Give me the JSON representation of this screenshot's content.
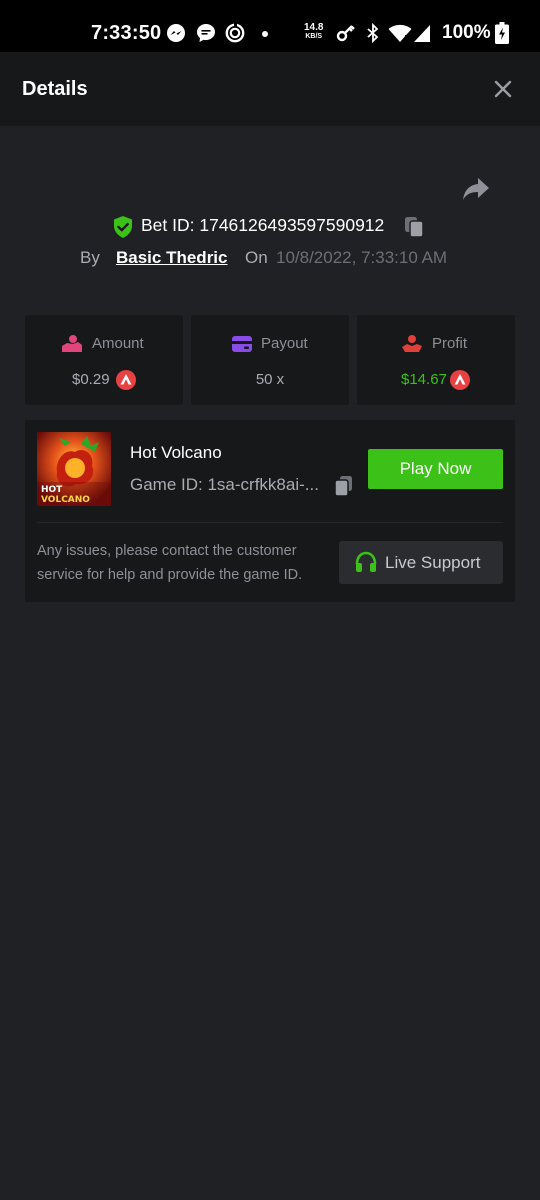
{
  "status_bar": {
    "time": "7:33:50",
    "network_speed_value": "14.8",
    "network_speed_unit": "KB/S",
    "battery": "100%"
  },
  "header": {
    "title": "Details"
  },
  "bet": {
    "id_text": "Bet ID: 1746126493597590912",
    "by_label": "By",
    "user": "Basic Thedric",
    "on_label": "On",
    "date": "10/8/2022, 7:33:10 AM"
  },
  "stats": {
    "amount": {
      "label": "Amount",
      "value": "$0.29",
      "icon": "money-hand-icon"
    },
    "payout": {
      "label": "Payout",
      "value": "50 x",
      "icon": "credit-card-icon"
    },
    "profit": {
      "label": "Profit",
      "value": "$14.67",
      "icon": "profit-hand-icon"
    }
  },
  "game": {
    "name": "Hot Volcano",
    "id_text": "Game ID: 1sa-crfkk8ai-...",
    "thumb_title_line1": "HOT",
    "thumb_title_line2": "VOLCANO",
    "play_label": "Play Now"
  },
  "support": {
    "message": "Any issues, please contact the customer service for help and provide the game ID.",
    "button_label": "Live Support"
  },
  "colors": {
    "background": "#202124",
    "card": "#17181a",
    "accent_green": "#3bc117",
    "profit_green": "#3bc117",
    "coin_red": "#e84142",
    "amount_pink": "#e0457b",
    "payout_purple": "#8a4ce8",
    "profit_red": "#e0403a"
  }
}
